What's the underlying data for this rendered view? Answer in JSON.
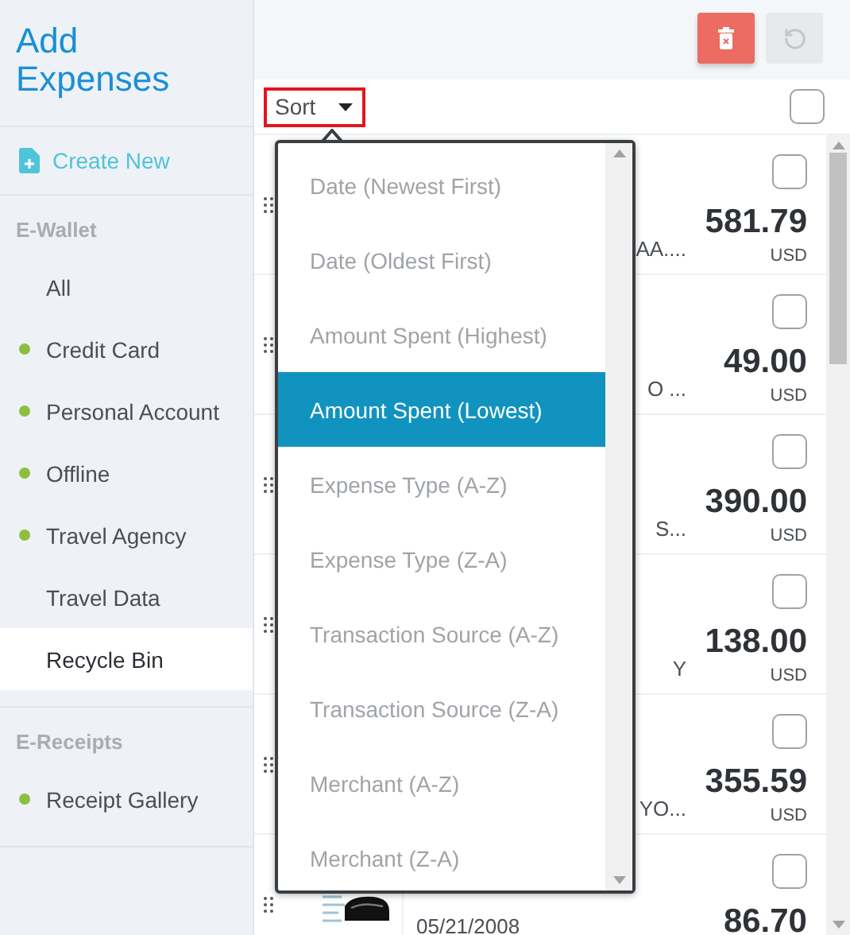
{
  "sidebar": {
    "title": "Add Expenses",
    "create_new": "Create New",
    "sections": [
      {
        "heading": "E-Wallet",
        "items": [
          {
            "label": "All",
            "selected": false
          },
          {
            "label": "Credit Card",
            "selected": false,
            "color": "#8cbf3f"
          },
          {
            "label": "Personal Account",
            "selected": false,
            "color": "#8cbf3f"
          },
          {
            "label": "Offline",
            "selected": false,
            "color": "#8cbf3f"
          },
          {
            "label": "Travel Agency",
            "selected": false,
            "color": "#8cbf3f"
          },
          {
            "label": "Travel Data",
            "selected": false
          },
          {
            "label": "Recycle Bin",
            "selected": true
          }
        ]
      },
      {
        "heading": "E-Receipts",
        "items": [
          {
            "label": "Receipt Gallery",
            "selected": false,
            "color": "#8cbf3f"
          }
        ]
      }
    ]
  },
  "toolbar": {
    "delete_enabled": true,
    "restore_enabled": false
  },
  "sort": {
    "label": "Sort",
    "select_all_checked": false,
    "options": [
      {
        "label": "Date (Newest First)",
        "selected": false
      },
      {
        "label": "Date (Oldest First)",
        "selected": false
      },
      {
        "label": "Amount Spent (Highest)",
        "selected": false
      },
      {
        "label": "Amount Spent (Lowest)",
        "selected": true
      },
      {
        "label": "Expense Type (A-Z)",
        "selected": false
      },
      {
        "label": "Expense Type (Z-A)",
        "selected": false
      },
      {
        "label": "Transaction Source (A-Z)",
        "selected": false
      },
      {
        "label": "Transaction Source (Z-A)",
        "selected": false
      },
      {
        "label": "Merchant (A-Z)",
        "selected": false
      },
      {
        "label": "Merchant (Z-A)",
        "selected": false
      }
    ]
  },
  "expenses": [
    {
      "merchant": "AA....",
      "amount": "581.79",
      "currency": "USD",
      "checked": false
    },
    {
      "merchant": "O ...",
      "amount": "49.00",
      "currency": "USD",
      "checked": false
    },
    {
      "merchant": "S...",
      "amount": "390.00",
      "currency": "USD",
      "checked": false
    },
    {
      "merchant": "Y",
      "amount": "138.00",
      "currency": "USD",
      "checked": false
    },
    {
      "merchant": "YO...",
      "amount": "355.59",
      "currency": "USD",
      "checked": false
    },
    {
      "date": "05/21/2008",
      "amount": "86.70",
      "checked": false
    }
  ]
}
